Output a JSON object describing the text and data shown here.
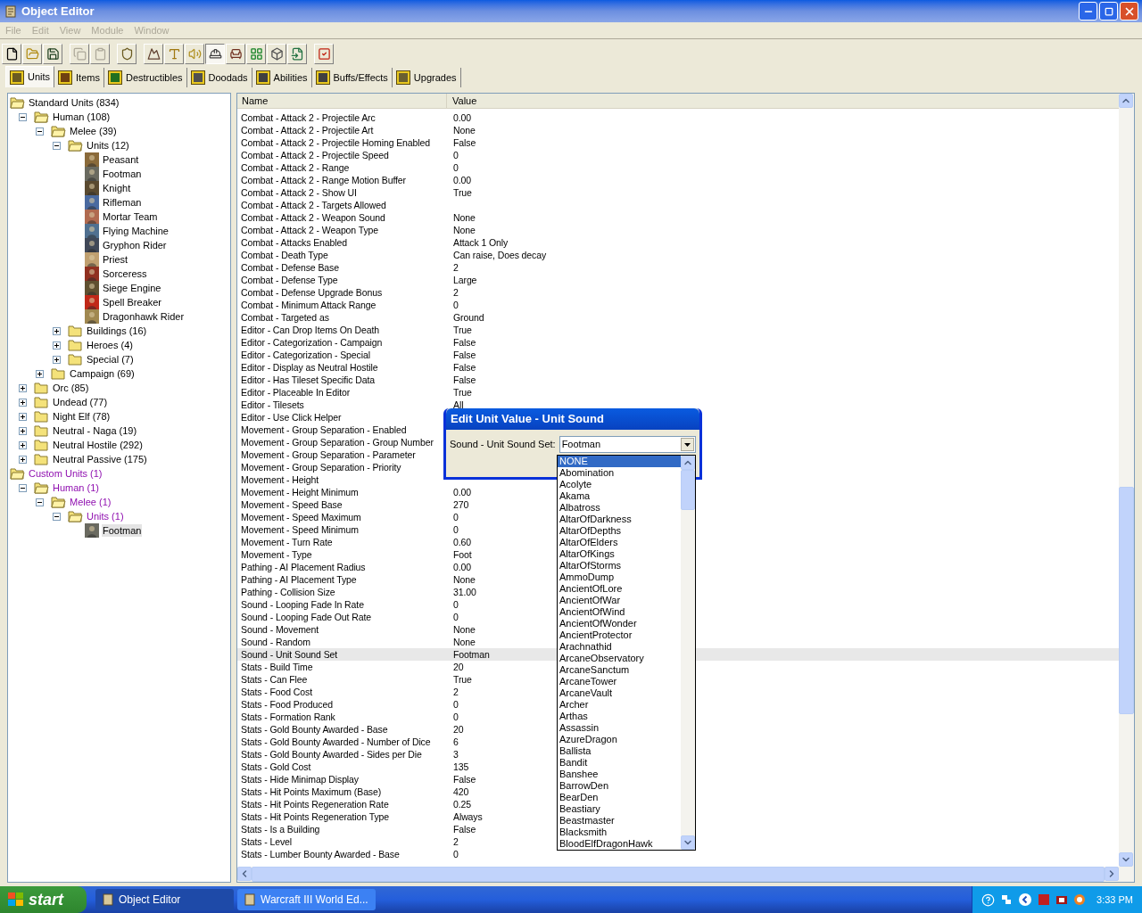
{
  "window": {
    "title": "Object Editor"
  },
  "menu": [
    {
      "label": "File",
      "disabled": true
    },
    {
      "label": "Edit",
      "disabled": true
    },
    {
      "label": "View",
      "disabled": true
    },
    {
      "label": "Module",
      "disabled": true
    },
    {
      "label": "Window",
      "disabled": true
    }
  ],
  "toolbar": [
    [
      {
        "kind": "new",
        "disabled": false,
        "pressed": false
      },
      {
        "kind": "open",
        "disabled": false,
        "pressed": false
      },
      {
        "kind": "save",
        "disabled": false,
        "pressed": false
      }
    ],
    [
      {
        "kind": "copy",
        "disabled": true,
        "pressed": false
      },
      {
        "kind": "paste",
        "disabled": true,
        "pressed": false
      }
    ],
    [
      {
        "kind": "helmet",
        "disabled": false,
        "pressed": false
      }
    ],
    [
      {
        "kind": "terrain",
        "disabled": false,
        "pressed": false
      },
      {
        "kind": "text",
        "disabled": false,
        "pressed": false
      },
      {
        "kind": "sound",
        "disabled": false,
        "pressed": false
      },
      {
        "kind": "unit",
        "disabled": false,
        "pressed": true
      },
      {
        "kind": "doodad",
        "disabled": false,
        "pressed": false
      },
      {
        "kind": "trigger",
        "disabled": false,
        "pressed": false
      },
      {
        "kind": "cube",
        "disabled": false,
        "pressed": false
      },
      {
        "kind": "import",
        "disabled": false,
        "pressed": false
      }
    ],
    [
      {
        "kind": "check",
        "disabled": false,
        "pressed": false
      }
    ]
  ],
  "tabs": [
    {
      "label": "Units",
      "selected": true
    },
    {
      "label": "Items",
      "selected": false
    },
    {
      "label": "Destructibles",
      "selected": false
    },
    {
      "label": "Doodads",
      "selected": false
    },
    {
      "label": "Abilities",
      "selected": false
    },
    {
      "label": "Buffs/Effects",
      "selected": false
    },
    {
      "label": "Upgrades",
      "selected": false
    }
  ],
  "tree": [
    {
      "label": "Standard Units (834)",
      "kind": "folder",
      "expanded": true,
      "modified": false,
      "selected": false,
      "children": [
        {
          "label": "Human (108)",
          "kind": "folder",
          "expanded": true,
          "modified": false,
          "selected": false,
          "children": [
            {
              "label": "Melee (39)",
              "kind": "folder",
              "expanded": true,
              "modified": false,
              "selected": false,
              "children": [
                {
                  "label": "Units (12)",
                  "kind": "folder",
                  "expanded": true,
                  "modified": false,
                  "selected": false,
                  "children": [
                    {
                      "label": "Peasant",
                      "kind": "unit",
                      "color": "#8a6a3a",
                      "modified": false,
                      "selected": false
                    },
                    {
                      "label": "Footman",
                      "kind": "unit",
                      "color": "#6a6a60",
                      "modified": false,
                      "selected": false
                    },
                    {
                      "label": "Knight",
                      "kind": "unit",
                      "color": "#5a4a30",
                      "modified": false,
                      "selected": false
                    },
                    {
                      "label": "Rifleman",
                      "kind": "unit",
                      "color": "#4a6aa0",
                      "modified": false,
                      "selected": false
                    },
                    {
                      "label": "Mortar Team",
                      "kind": "unit",
                      "color": "#b06a50",
                      "modified": false,
                      "selected": false
                    },
                    {
                      "label": "Flying Machine",
                      "kind": "unit",
                      "color": "#507090",
                      "modified": false,
                      "selected": false
                    },
                    {
                      "label": "Gryphon Rider",
                      "kind": "unit",
                      "color": "#404858",
                      "modified": false,
                      "selected": false
                    },
                    {
                      "label": "Priest",
                      "kind": "unit",
                      "color": "#c0a070",
                      "modified": false,
                      "selected": false
                    },
                    {
                      "label": "Sorceress",
                      "kind": "unit",
                      "color": "#903020",
                      "modified": false,
                      "selected": false
                    },
                    {
                      "label": "Siege Engine",
                      "kind": "unit",
                      "color": "#605030",
                      "modified": false,
                      "selected": false
                    },
                    {
                      "label": "Spell Breaker",
                      "kind": "unit",
                      "color": "#c02818",
                      "modified": false,
                      "selected": false
                    },
                    {
                      "label": "Dragonhawk Rider",
                      "kind": "unit",
                      "color": "#a08850",
                      "modified": false,
                      "selected": false
                    }
                  ]
                },
                {
                  "label": "Buildings (16)",
                  "kind": "folder",
                  "expanded": false,
                  "modified": false,
                  "selected": false
                },
                {
                  "label": "Heroes (4)",
                  "kind": "folder",
                  "expanded": false,
                  "modified": false,
                  "selected": false
                },
                {
                  "label": "Special (7)",
                  "kind": "folder",
                  "expanded": false,
                  "modified": false,
                  "selected": false
                }
              ]
            },
            {
              "label": "Campaign (69)",
              "kind": "folder",
              "expanded": false,
              "modified": false,
              "selected": false
            }
          ]
        },
        {
          "label": "Orc (85)",
          "kind": "folder",
          "expanded": false,
          "modified": false,
          "selected": false
        },
        {
          "label": "Undead (77)",
          "kind": "folder",
          "expanded": false,
          "modified": false,
          "selected": false
        },
        {
          "label": "Night Elf (78)",
          "kind": "folder",
          "expanded": false,
          "modified": false,
          "selected": false
        },
        {
          "label": "Neutral - Naga (19)",
          "kind": "folder",
          "expanded": false,
          "modified": false,
          "selected": false
        },
        {
          "label": "Neutral Hostile (292)",
          "kind": "folder",
          "expanded": false,
          "modified": false,
          "selected": false
        },
        {
          "label": "Neutral Passive (175)",
          "kind": "folder",
          "expanded": false,
          "modified": false,
          "selected": false
        }
      ]
    },
    {
      "label": "Custom Units (1)",
      "kind": "folder",
      "expanded": true,
      "modified": true,
      "selected": false,
      "children": [
        {
          "label": "Human (1)",
          "kind": "folder",
          "expanded": true,
          "modified": true,
          "selected": false,
          "children": [
            {
              "label": "Melee (1)",
              "kind": "folder",
              "expanded": true,
              "modified": true,
              "selected": false,
              "children": [
                {
                  "label": "Units (1)",
                  "kind": "folder",
                  "expanded": true,
                  "modified": true,
                  "selected": false,
                  "children": [
                    {
                      "label": "Footman",
                      "kind": "unit",
                      "color": "#6a6a60",
                      "modified": false,
                      "selected": true
                    }
                  ]
                }
              ]
            }
          ]
        }
      ]
    }
  ],
  "table": {
    "columns": [
      "Name",
      "Value"
    ],
    "rows": [
      {
        "name": "Combat - Attack 2 - Projectile Arc",
        "value": "0.00",
        "selected": false
      },
      {
        "name": "Combat - Attack 2 - Projectile Art",
        "value": "None",
        "selected": false
      },
      {
        "name": "Combat - Attack 2 - Projectile Homing Enabled",
        "value": "False",
        "selected": false
      },
      {
        "name": "Combat - Attack 2 - Projectile Speed",
        "value": "0",
        "selected": false
      },
      {
        "name": "Combat - Attack 2 - Range",
        "value": "0",
        "selected": false
      },
      {
        "name": "Combat - Attack 2 - Range Motion Buffer",
        "value": "0.00",
        "selected": false
      },
      {
        "name": "Combat - Attack 2 - Show UI",
        "value": "True",
        "selected": false
      },
      {
        "name": "Combat - Attack 2 - Targets Allowed",
        "selected": false
      },
      {
        "name": "Combat - Attack 2 - Weapon Sound",
        "value": "None",
        "selected": false
      },
      {
        "name": "Combat - Attack 2 - Weapon Type",
        "value": "None",
        "selected": false
      },
      {
        "name": "Combat - Attacks Enabled",
        "value": "Attack 1 Only",
        "selected": false
      },
      {
        "name": "Combat - Death Type",
        "value": "Can raise, Does decay",
        "selected": false
      },
      {
        "name": "Combat - Defense Base",
        "value": "2",
        "selected": false
      },
      {
        "name": "Combat - Defense Type",
        "value": "Large",
        "selected": false
      },
      {
        "name": "Combat - Defense Upgrade Bonus",
        "value": "2",
        "selected": false
      },
      {
        "name": "Combat - Minimum Attack Range",
        "value": "0",
        "selected": false
      },
      {
        "name": "Combat - Targeted as",
        "value": "Ground",
        "selected": false
      },
      {
        "name": "Editor - Can Drop Items On Death",
        "value": "True",
        "selected": false
      },
      {
        "name": "Editor - Categorization - Campaign",
        "value": "False",
        "selected": false
      },
      {
        "name": "Editor - Categorization - Special",
        "value": "False",
        "selected": false
      },
      {
        "name": "Editor - Display as Neutral Hostile",
        "value": "False",
        "selected": false
      },
      {
        "name": "Editor - Has Tileset Specific Data",
        "value": "False",
        "selected": false
      },
      {
        "name": "Editor - Placeable In Editor",
        "value": "True",
        "selected": false
      },
      {
        "name": "Editor - Tilesets",
        "value": "All",
        "selected": false
      },
      {
        "name": "Editor - Use Click Helper",
        "selected": false
      },
      {
        "name": "Movement - Group Separation - Enabled",
        "selected": false
      },
      {
        "name": "Movement - Group Separation - Group Number",
        "selected": false
      },
      {
        "name": "Movement - Group Separation - Parameter",
        "selected": false
      },
      {
        "name": "Movement - Group Separation - Priority",
        "selected": false
      },
      {
        "name": "Movement - Height",
        "selected": false
      },
      {
        "name": "Movement - Height Minimum",
        "value": "0.00",
        "selected": false
      },
      {
        "name": "Movement - Speed Base",
        "value": "270",
        "selected": false
      },
      {
        "name": "Movement - Speed Maximum",
        "value": "0",
        "selected": false
      },
      {
        "name": "Movement - Speed Minimum",
        "value": "0",
        "selected": false
      },
      {
        "name": "Movement - Turn Rate",
        "value": "0.60",
        "selected": false
      },
      {
        "name": "Movement - Type",
        "value": "Foot",
        "selected": false
      },
      {
        "name": "Pathing - AI Placement Radius",
        "value": "0.00",
        "selected": false
      },
      {
        "name": "Pathing - AI Placement Type",
        "value": "None",
        "selected": false
      },
      {
        "name": "Pathing - Collision Size",
        "value": "31.00",
        "selected": false
      },
      {
        "name": "Sound - Looping Fade In Rate",
        "value": "0",
        "selected": false
      },
      {
        "name": "Sound - Looping Fade Out Rate",
        "value": "0",
        "selected": false
      },
      {
        "name": "Sound - Movement",
        "value": "None",
        "selected": false
      },
      {
        "name": "Sound - Random",
        "value": "None",
        "selected": false
      },
      {
        "name": "Sound - Unit Sound Set",
        "value": "Footman",
        "selected": true
      },
      {
        "name": "Stats - Build Time",
        "value": "20",
        "selected": false
      },
      {
        "name": "Stats - Can Flee",
        "value": "True",
        "selected": false
      },
      {
        "name": "Stats - Food Cost",
        "value": "2",
        "selected": false
      },
      {
        "name": "Stats - Food Produced",
        "value": "0",
        "selected": false
      },
      {
        "name": "Stats - Formation Rank",
        "value": "0",
        "selected": false
      },
      {
        "name": "Stats - Gold Bounty Awarded - Base",
        "value": "20",
        "selected": false
      },
      {
        "name": "Stats - Gold Bounty Awarded - Number of Dice",
        "value": "6",
        "selected": false
      },
      {
        "name": "Stats - Gold Bounty Awarded - Sides per Die",
        "value": "3",
        "selected": false
      },
      {
        "name": "Stats - Gold Cost",
        "value": "135",
        "selected": false
      },
      {
        "name": "Stats - Hide Minimap Display",
        "value": "False",
        "selected": false
      },
      {
        "name": "Stats - Hit Points Maximum (Base)",
        "value": "420",
        "selected": false
      },
      {
        "name": "Stats - Hit Points Regeneration Rate",
        "value": "0.25",
        "selected": false
      },
      {
        "name": "Stats - Hit Points Regeneration Type",
        "value": "Always",
        "selected": false
      },
      {
        "name": "Stats - Is a Building",
        "value": "False",
        "selected": false
      },
      {
        "name": "Stats - Level",
        "value": "2",
        "selected": false
      },
      {
        "name": "Stats - Lumber Bounty Awarded - Base",
        "value": "0",
        "selected": false
      }
    ]
  },
  "dialog": {
    "title": "Edit Unit Value - Unit Sound",
    "label": "Sound - Unit Sound Set:",
    "value": "Footman",
    "options": [
      {
        "label": "NONE",
        "selected": true
      },
      {
        "label": "Abomination",
        "selected": false
      },
      {
        "label": "Acolyte",
        "selected": false
      },
      {
        "label": "Akama",
        "selected": false
      },
      {
        "label": "Albatross",
        "selected": false
      },
      {
        "label": "AltarOfDarkness",
        "selected": false
      },
      {
        "label": "AltarOfDepths",
        "selected": false
      },
      {
        "label": "AltarOfElders",
        "selected": false
      },
      {
        "label": "AltarOfKings",
        "selected": false
      },
      {
        "label": "AltarOfStorms",
        "selected": false
      },
      {
        "label": "AmmoDump",
        "selected": false
      },
      {
        "label": "AncientOfLore",
        "selected": false
      },
      {
        "label": "AncientOfWar",
        "selected": false
      },
      {
        "label": "AncientOfWind",
        "selected": false
      },
      {
        "label": "AncientOfWonder",
        "selected": false
      },
      {
        "label": "AncientProtector",
        "selected": false
      },
      {
        "label": "Arachnathid",
        "selected": false
      },
      {
        "label": "ArcaneObservatory",
        "selected": false
      },
      {
        "label": "ArcaneSanctum",
        "selected": false
      },
      {
        "label": "ArcaneTower",
        "selected": false
      },
      {
        "label": "ArcaneVault",
        "selected": false
      },
      {
        "label": "Archer",
        "selected": false
      },
      {
        "label": "Arthas",
        "selected": false
      },
      {
        "label": "Assassin",
        "selected": false
      },
      {
        "label": "AzureDragon",
        "selected": false
      },
      {
        "label": "Ballista",
        "selected": false
      },
      {
        "label": "Bandit",
        "selected": false
      },
      {
        "label": "Banshee",
        "selected": false
      },
      {
        "label": "BarrowDen",
        "selected": false
      },
      {
        "label": "BearDen",
        "selected": false
      },
      {
        "label": "Beastiary",
        "selected": false
      },
      {
        "label": "Beastmaster",
        "selected": false
      },
      {
        "label": "Blacksmith",
        "selected": false
      },
      {
        "label": "BloodElfDragonHawk",
        "selected": false
      }
    ]
  },
  "taskbar": {
    "start": "start",
    "tasks": [
      {
        "label": "Object Editor",
        "selected": true
      },
      {
        "label": "Warcraft III World Ed...",
        "selected": false
      }
    ],
    "clock": "3:33 PM"
  }
}
